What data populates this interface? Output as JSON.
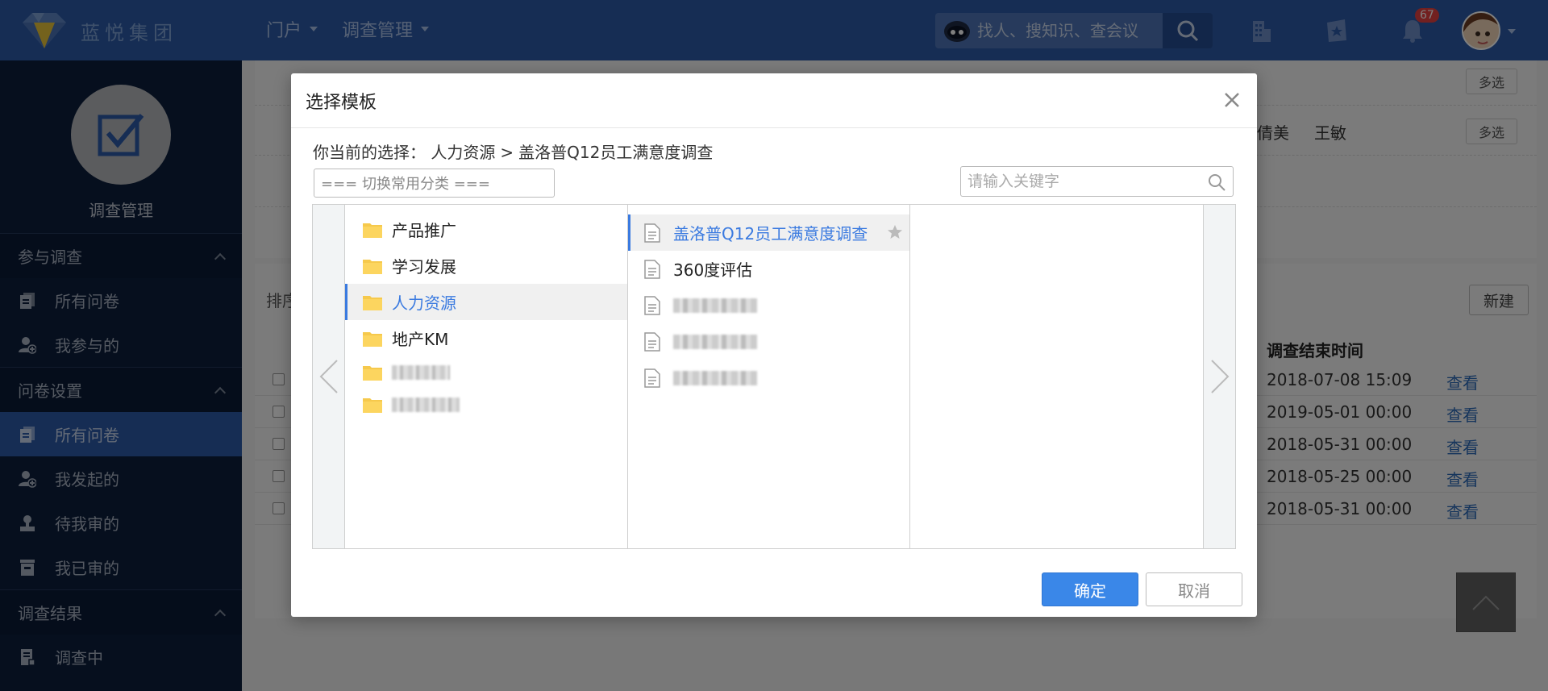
{
  "topbar": {
    "logo_text": "蓝悦集团",
    "nav": [
      {
        "label": "门户"
      },
      {
        "label": "调查管理"
      }
    ],
    "search_placeholder": "找人、搜知识、查会议",
    "notification_count": "67"
  },
  "sidebar": {
    "title": "调查管理",
    "sections": [
      {
        "label": "参与调查",
        "items": [
          {
            "label": "所有问卷",
            "icon": "document-list-icon",
            "active": false
          },
          {
            "label": "我参与的",
            "icon": "user-add-icon",
            "active": false
          }
        ]
      },
      {
        "label": "问卷设置",
        "items": [
          {
            "label": "所有问卷",
            "icon": "document-list-icon",
            "active": true
          },
          {
            "label": "我发起的",
            "icon": "user-add-icon",
            "active": false
          },
          {
            "label": "待我审的",
            "icon": "stamp-icon",
            "active": false
          },
          {
            "label": "我已审的",
            "icon": "archive-icon",
            "active": false
          }
        ]
      },
      {
        "label": "调查结果",
        "items": [
          {
            "label": "调查中",
            "icon": "report-icon",
            "active": false
          }
        ]
      }
    ]
  },
  "background": {
    "multi_select_label": "多选",
    "names": [
      "倩美",
      "王敏"
    ],
    "sort_label": "排序",
    "new_button": "新建",
    "end_time_header": "调查结束时间",
    "rows": [
      {
        "date": "2018-07-08 15:09",
        "action": "查看"
      },
      {
        "date": "2019-05-01 00:00",
        "action": "查看"
      },
      {
        "date": "2018-05-31 00:00",
        "action": "查看"
      },
      {
        "date": "2018-05-25 00:00",
        "action": "查看"
      },
      {
        "date": "2018-05-31 00:00",
        "action": "查看"
      }
    ]
  },
  "modal": {
    "title": "选择模板",
    "current_selection_label": "你当前的选择：",
    "current_category": "人力资源",
    "current_template": "盖洛普Q12员工满意度调查",
    "category_select_placeholder": "=== 切换常用分类 ===",
    "keyword_placeholder": "请输入关键字",
    "categories": [
      {
        "label": "产品推广",
        "selected": false
      },
      {
        "label": "学习发展",
        "selected": false
      },
      {
        "label": "人力资源",
        "selected": true
      },
      {
        "label": "地产KM",
        "selected": false
      }
    ],
    "templates": [
      {
        "label": "盖洛普Q12员工满意度调查",
        "selected": true
      },
      {
        "label": "360度评估",
        "selected": false
      }
    ],
    "ok_label": "确定",
    "cancel_label": "取消"
  },
  "colors": {
    "topbar": "#2d5ba8",
    "sidebar": "#0c1e3d",
    "accent": "#3a87e8",
    "selected_text": "#3a7ae0",
    "badge": "#e54040"
  }
}
